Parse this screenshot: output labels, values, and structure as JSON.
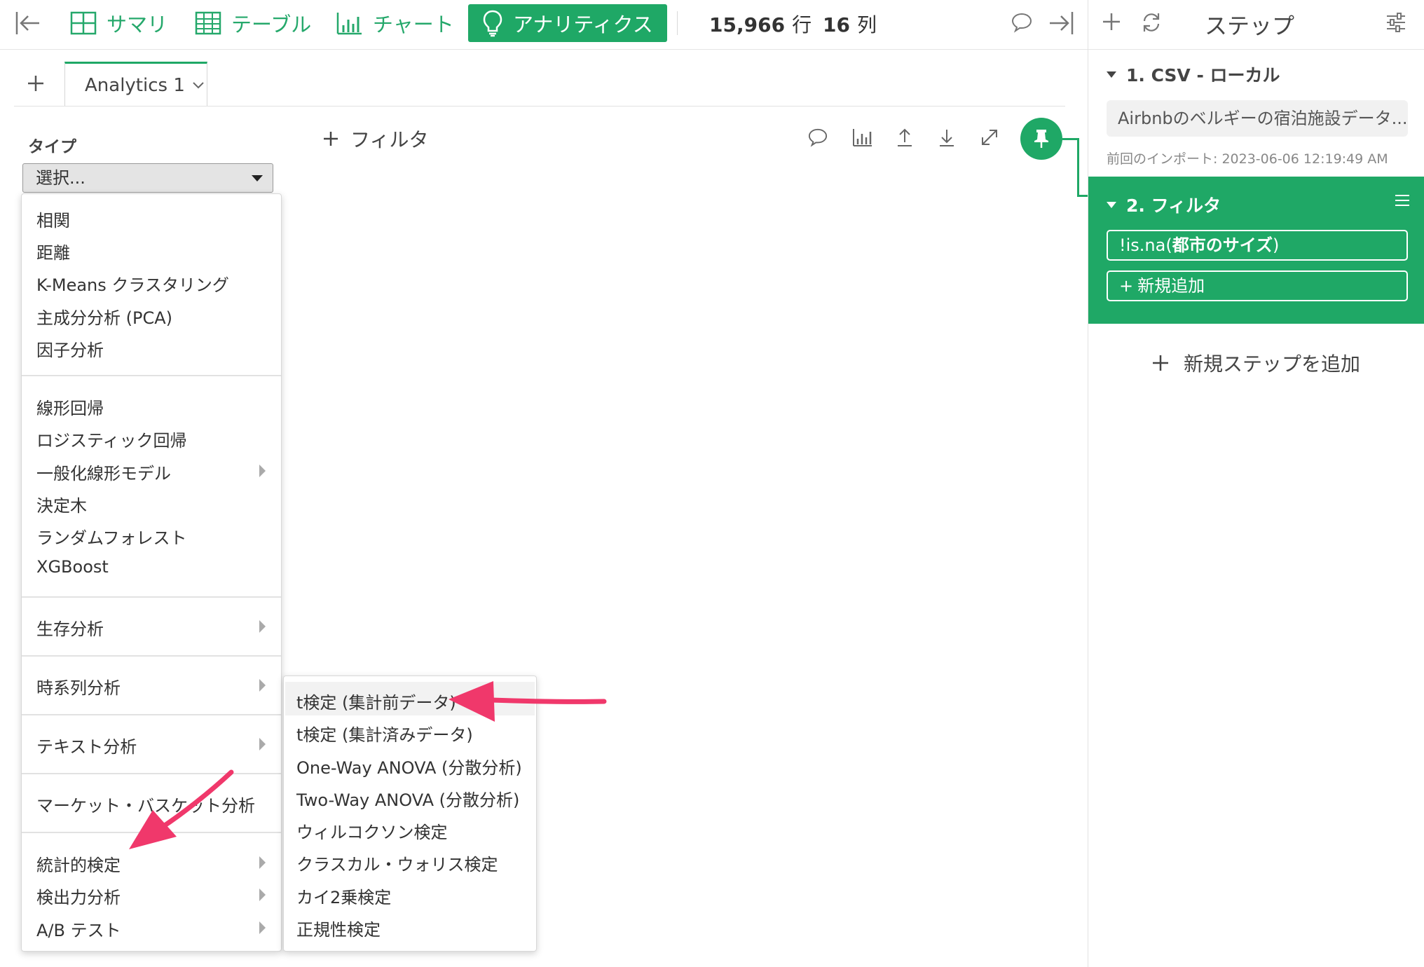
{
  "topbar": {
    "tabs": [
      {
        "label": "サマリ",
        "icon": "summary-grid-icon"
      },
      {
        "label": "テーブル",
        "icon": "table-icon"
      },
      {
        "label": "チャート",
        "icon": "bar-chart-icon"
      },
      {
        "label": "アナリティクス",
        "icon": "lightbulb-icon",
        "active": true
      }
    ],
    "rows_value": "15,966",
    "rows_unit": "行",
    "cols_value": "16",
    "cols_unit": "列"
  },
  "analytics": {
    "tab_label": "Analytics 1",
    "type_label": "タイプ",
    "type_select_value": "選択...",
    "filter_label": "フィルタ"
  },
  "menu": {
    "items": [
      "相関",
      "距離",
      "K-Means クラスタリング",
      "主成分分析 (PCA)",
      "因子分析",
      "線形回帰",
      "ロジスティック回帰",
      "一般化線形モデル",
      "決定木",
      "ランダムフォレスト",
      "XGBoost",
      "生存分析",
      "時系列分析",
      "テキスト分析",
      "マーケット・バスケット分析",
      "統計的検定",
      "検出力分析",
      "A/B テスト"
    ]
  },
  "submenu": {
    "items": [
      "t検定 (集計前データ)",
      "t検定 (集計済みデータ)",
      "One-Way ANOVA (分散分析)",
      "Two-Way ANOVA (分散分析)",
      "ウィルコクソン検定",
      "クラスカル・ウォリス検定",
      "カイ2乗検定",
      "正規性検定"
    ]
  },
  "steps": {
    "title": "ステップ",
    "step1_title": "1. CSV - ローカル",
    "step1_source": "Airbnbのベルギーの宿泊施設データ...",
    "step1_import": "前回のインポート: 2023-06-06 12:19:49 AM",
    "step2_title": "2. フィルタ",
    "filter_item_prefix": "!is.na(",
    "filter_item_bold": "都市のサイズ",
    "filter_item_suffix": ")",
    "add_new": "新規追加",
    "add_step": "新規ステップを追加"
  },
  "colors": {
    "accent": "#1fa866",
    "annotation_arrow": "#f0386b"
  }
}
